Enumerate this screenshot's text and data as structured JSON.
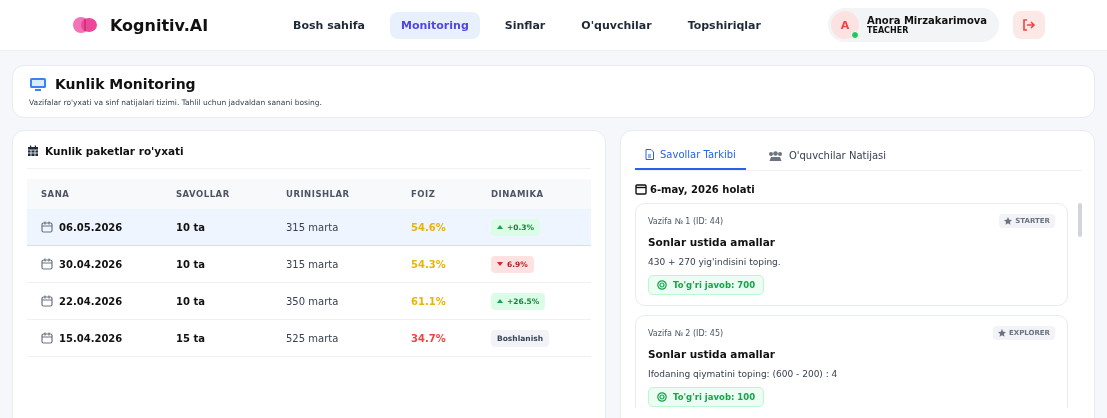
{
  "brand": "Kognitiv.AI",
  "nav": [
    {
      "label": "Bosh sahifa",
      "selected": false
    },
    {
      "label": "Monitoring",
      "selected": true
    },
    {
      "label": "Sinflar",
      "selected": false
    },
    {
      "label": "O'quvchilar",
      "selected": false
    },
    {
      "label": "Topshiriqlar",
      "selected": false
    }
  ],
  "user": {
    "initial": "A",
    "name": "Anora Mirzakarimova",
    "role": "TEACHER",
    "online": true
  },
  "page": {
    "title": "Kunlik Monitoring",
    "subtitle": "Vazifalar ro'yxati va sinf natijalari tizimi. Tahlil uchun jadvaldan sanani bosing."
  },
  "table": {
    "title": "Kunlik paketlar ro'yxati",
    "columns": [
      "SANA",
      "SAVOLLAR",
      "URINISHLAR",
      "FOIZ",
      "DINAMIKA"
    ],
    "rows": [
      {
        "date": "06.05.2026",
        "questions": "10 ta",
        "attempts": "315 marta",
        "percent": "54.6%",
        "color": "#eab308",
        "trend": {
          "kind": "up",
          "text": "+0.3%"
        },
        "selected": true
      },
      {
        "date": "30.04.2026",
        "questions": "10 ta",
        "attempts": "315 marta",
        "percent": "54.3%",
        "color": "#eab308",
        "trend": {
          "kind": "down",
          "text": "6.9%"
        },
        "selected": false
      },
      {
        "date": "22.04.2026",
        "questions": "10 ta",
        "attempts": "350 marta",
        "percent": "61.1%",
        "color": "#eab308",
        "trend": {
          "kind": "up",
          "text": "+26.5%"
        },
        "selected": false
      },
      {
        "date": "15.04.2026",
        "questions": "15 ta",
        "attempts": "525 marta",
        "percent": "34.7%",
        "color": "#ef4444",
        "trend": {
          "kind": "start",
          "text": "Boshlanish"
        },
        "selected": false
      }
    ]
  },
  "detail": {
    "tabs": [
      {
        "label": "Savollar Tarkibi",
        "kind": "doc",
        "selected": true
      },
      {
        "label": "O'quvchilar Natijasi",
        "kind": "users",
        "selected": false
      }
    ],
    "heading": "6-may, 2026 holati",
    "tasks": [
      {
        "meta": "Vazifa № 1 (ID: 44)",
        "level": "STARTER",
        "title": "Sonlar ustida amallar",
        "question": "430 + 270 yig'indisini toping.",
        "answer": "To'g'ri javob: 700"
      },
      {
        "meta": "Vazifa № 2 (ID: 45)",
        "level": "EXPLORER",
        "title": "Sonlar ustida amallar",
        "question": "Ifodaning qiymatini toping: (600 - 200) : 4",
        "answer": "To'g'ri javob: 100"
      }
    ]
  }
}
